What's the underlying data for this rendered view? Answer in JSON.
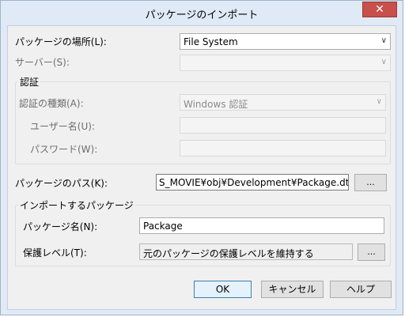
{
  "window": {
    "title": "パッケージのインポート",
    "close_glyph": "✕"
  },
  "location": {
    "label": "パッケージの場所(L):",
    "value": "File System",
    "arrow": "∨"
  },
  "server": {
    "label": "サーバー(S):",
    "value": "",
    "arrow": "∨"
  },
  "auth_group": {
    "title": "認証",
    "type_label": "認証の種類(A):",
    "type_value": "Windows 認証",
    "type_arrow": "∨",
    "username_label": "ユーザー名(U):",
    "password_label": "パスワード(W):"
  },
  "package_path": {
    "label": "パッケージのパス(K):",
    "value": "S_MOVIE¥obj¥Development¥Package.dtsx",
    "browse_label": "..."
  },
  "import_group": {
    "title": "インポートするパッケージ",
    "name_label": "パッケージ名(N):",
    "name_value": "Package",
    "protection_label": "保護レベル(T):",
    "protection_value": "元のパッケージの保護レベルを維持する",
    "protection_button_label": "..."
  },
  "buttons": {
    "ok": "OK",
    "cancel": "キャンセル",
    "help": "ヘルプ"
  }
}
